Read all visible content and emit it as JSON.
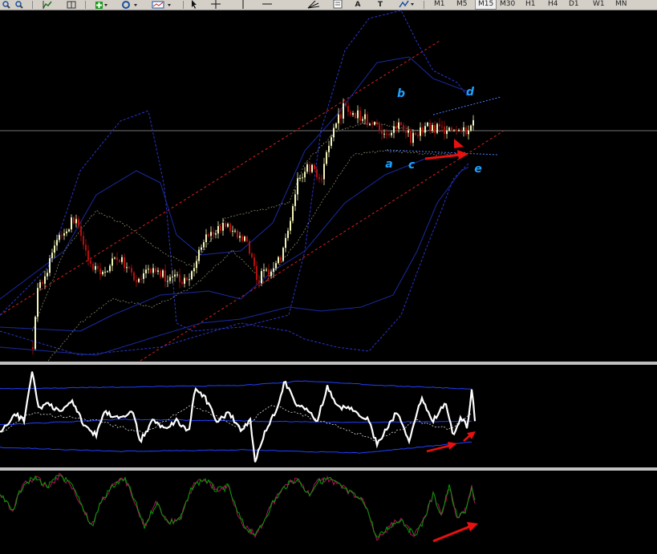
{
  "toolbar": {
    "icons": [
      "zoom-in-icon",
      "zoom-out-icon",
      "indicator-list-icon",
      "period-separator-icon",
      "new-order-icon",
      "auto-trading-icon",
      "template-icon",
      "cursor-icon",
      "crosshair-icon",
      "vertical-line-icon",
      "horizontal-line-icon",
      "fibonacci-fan-icon",
      "text-icon",
      "text-label-icon",
      "arrows-icon"
    ],
    "text_tools": {
      "text": "A",
      "label": "T"
    },
    "timeframes": [
      "M1",
      "M5",
      "M15",
      "M30",
      "H1",
      "H4",
      "D1",
      "W1",
      "MN"
    ],
    "active_timeframe": "M15"
  },
  "chart": {
    "wave_labels": [
      "a",
      "b",
      "c",
      "d",
      "e"
    ],
    "label_color": "#1fa0ff",
    "bull_candle_color": "#f2f2b8",
    "bear_candle_color": "#b01010",
    "channel_color": "#e02020",
    "bollinger_color": "#2a35c8",
    "envelope_color": "#1a2aa0",
    "arrow_color": "#e81010",
    "hline_color": "#9a9a9a"
  },
  "oscillator": {
    "line_color": "#ffffff",
    "band_color": "#2040ff",
    "signal_color": "#ffffff"
  },
  "stochastic": {
    "main_color": "#00a000",
    "signal_color": "#b01060"
  }
}
